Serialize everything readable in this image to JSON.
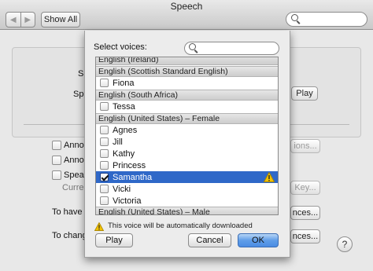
{
  "window": {
    "title": "Speech",
    "back_glyph": "◀",
    "forward_glyph": "▶",
    "show_all_label": "Show All",
    "search_icon": "magnifier-icon"
  },
  "background": {
    "row1_label": "S",
    "row2_label": "Sp",
    "play_label": "Play",
    "announce1_label": "Annou",
    "announce2_label": "Annou",
    "speak_label": "Speak",
    "current_label": "Curre",
    "options_label": "ions...",
    "key_label": "Key...",
    "have_label": "To have",
    "have_btn_label": "nces...",
    "change_label": "To chang",
    "change_btn_label": "nces...",
    "help_label": "?"
  },
  "sheet": {
    "title": "Select voices:",
    "search_placeholder": "",
    "groups": [
      {
        "header": "English (Ireland)"
      },
      {
        "header": "English (Scottish Standard English)",
        "voices": [
          {
            "name": "Fiona",
            "checked": false
          }
        ]
      },
      {
        "header": "English (South Africa)",
        "voices": [
          {
            "name": "Tessa",
            "checked": false
          }
        ]
      },
      {
        "header": "English (United States) – Female",
        "voices": [
          {
            "name": "Agnes",
            "checked": false
          },
          {
            "name": "Jill",
            "checked": false
          },
          {
            "name": "Kathy",
            "checked": false
          },
          {
            "name": "Princess",
            "checked": false
          },
          {
            "name": "Samantha",
            "checked": true,
            "selected": true,
            "warning": "warning-icon"
          },
          {
            "name": "Vicki",
            "checked": false
          },
          {
            "name": "Victoria",
            "checked": false
          }
        ]
      },
      {
        "header": "English (United States) – Male"
      }
    ],
    "notice": "This voice will be automatically downloaded",
    "play_label": "Play",
    "cancel_label": "Cancel",
    "ok_label": "OK"
  },
  "colors": {
    "selection": "#2f68c8",
    "default_button": "#5f9de8",
    "warning": "#f2c200"
  }
}
